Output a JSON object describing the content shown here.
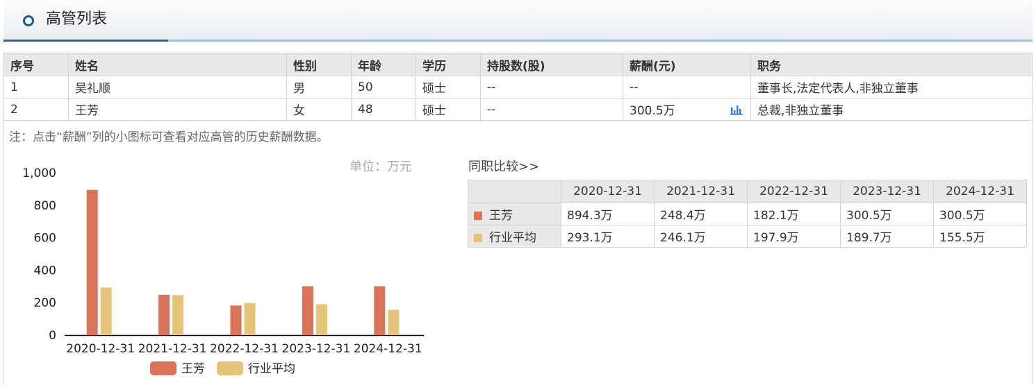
{
  "header": {
    "title": "高管列表"
  },
  "table": {
    "columns": [
      "序号",
      "姓名",
      "性别",
      "年龄",
      "学历",
      "持股数(股)",
      "薪酬(元)",
      "职务"
    ],
    "rows": [
      [
        "1",
        "吴礼顺",
        "男",
        "50",
        "硕士",
        "--",
        "--",
        "董事长,法定代表人,非独立董事"
      ],
      [
        "2",
        "王芳",
        "女",
        "48",
        "硕士",
        "--",
        "300.5万",
        "总裁,非独立董事"
      ]
    ]
  },
  "note": "注：点击“薪酬”列的小图标可查看对应高管的历史薪酬数据。",
  "unit_label": "单位：万元",
  "compare": {
    "title": "同职比较>>",
    "headers": [
      "2020-12-31",
      "2021-12-31",
      "2022-12-31",
      "2023-12-31",
      "2024-12-31"
    ],
    "rows": [
      {
        "name": "王芳",
        "values": [
          "894.3万",
          "248.4万",
          "182.1万",
          "300.5万",
          "300.5万"
        ]
      },
      {
        "name": "行业平均",
        "values": [
          "293.1万",
          "246.1万",
          "197.9万",
          "189.7万",
          "155.5万"
        ]
      }
    ]
  },
  "colors": {
    "series1": "#d9735a",
    "series2": "#e5c47a",
    "icon": "#3a7cc4"
  },
  "chart_data": {
    "type": "bar",
    "categories": [
      "2020-12-31",
      "2021-12-31",
      "2022-12-31",
      "2023-12-31",
      "2024-12-31"
    ],
    "series": [
      {
        "name": "王芳",
        "values": [
          894.3,
          248.4,
          182.1,
          300.5,
          300.5
        ]
      },
      {
        "name": "行业平均",
        "values": [
          293.1,
          246.1,
          197.9,
          189.7,
          155.5
        ]
      }
    ],
    "yticks": [
      "0",
      "200",
      "400",
      "600",
      "800",
      "1,000"
    ],
    "ylim": [
      0,
      1000
    ],
    "legend": "bottom-center",
    "grid": false
  }
}
